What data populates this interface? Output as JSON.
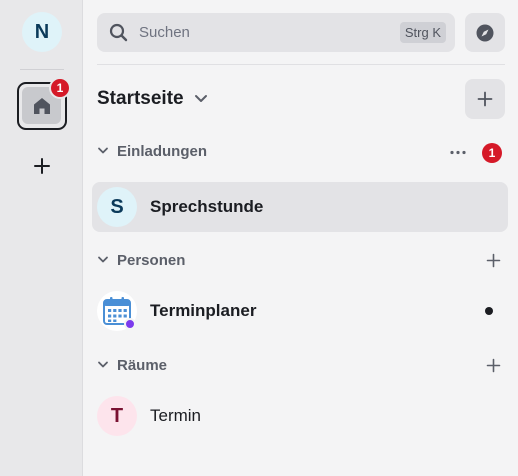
{
  "account": {
    "initial": "N"
  },
  "spaces": {
    "home_badge": "1"
  },
  "search": {
    "placeholder": "Suchen",
    "shortcut": "Strg K"
  },
  "home": {
    "title": "Startseite"
  },
  "sections": [
    {
      "label": "Einladungen",
      "badge": "1"
    },
    {
      "label": "Personen"
    },
    {
      "label": "Räume"
    }
  ],
  "rooms": [
    {
      "initial": "S",
      "name": "Sprechstunde",
      "avatar_bg": "#dff3f9",
      "avatar_fg": "#0b3a5a"
    },
    {
      "name": "Terminplaner"
    },
    {
      "initial": "T",
      "name": "Termin",
      "avatar_bg": "#fde4ec",
      "avatar_fg": "#7a1232"
    }
  ],
  "colors": {
    "badge": "#d51928",
    "presence": "#7c3aed",
    "calendar": "#4a8fd6"
  }
}
